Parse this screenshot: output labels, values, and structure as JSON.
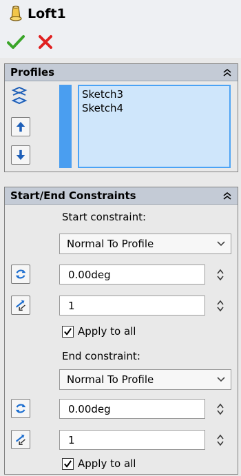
{
  "header": {
    "title": "Loft1",
    "feature_icon": "loft-feature-icon",
    "ok_icon": "green-check-icon",
    "cancel_icon": "red-x-icon"
  },
  "profiles": {
    "title": "Profiles",
    "items": [
      "Sketch3",
      "Sketch4"
    ],
    "icons": [
      "profiles-selector-icon",
      "move-up-icon",
      "move-down-icon"
    ]
  },
  "constraints": {
    "title": "Start/End Constraints",
    "start": {
      "label": "Start constraint:",
      "selected": "Normal To Profile",
      "angle": "0.00deg",
      "tangent_length": "1",
      "apply_all": "Apply to all",
      "apply_all_checked": true
    },
    "end": {
      "label": "End constraint:",
      "selected": "Normal To Profile",
      "angle": "0.00deg",
      "tangent_length": "1",
      "apply_all": "Apply to all",
      "apply_all_checked": true
    }
  },
  "colors": {
    "header_bg": "#c4cbd6",
    "selection_bar": "#4a9ef0",
    "list_bg": "#cfe6fb",
    "ok_green": "#3aa529",
    "cancel_red": "#e02020"
  }
}
